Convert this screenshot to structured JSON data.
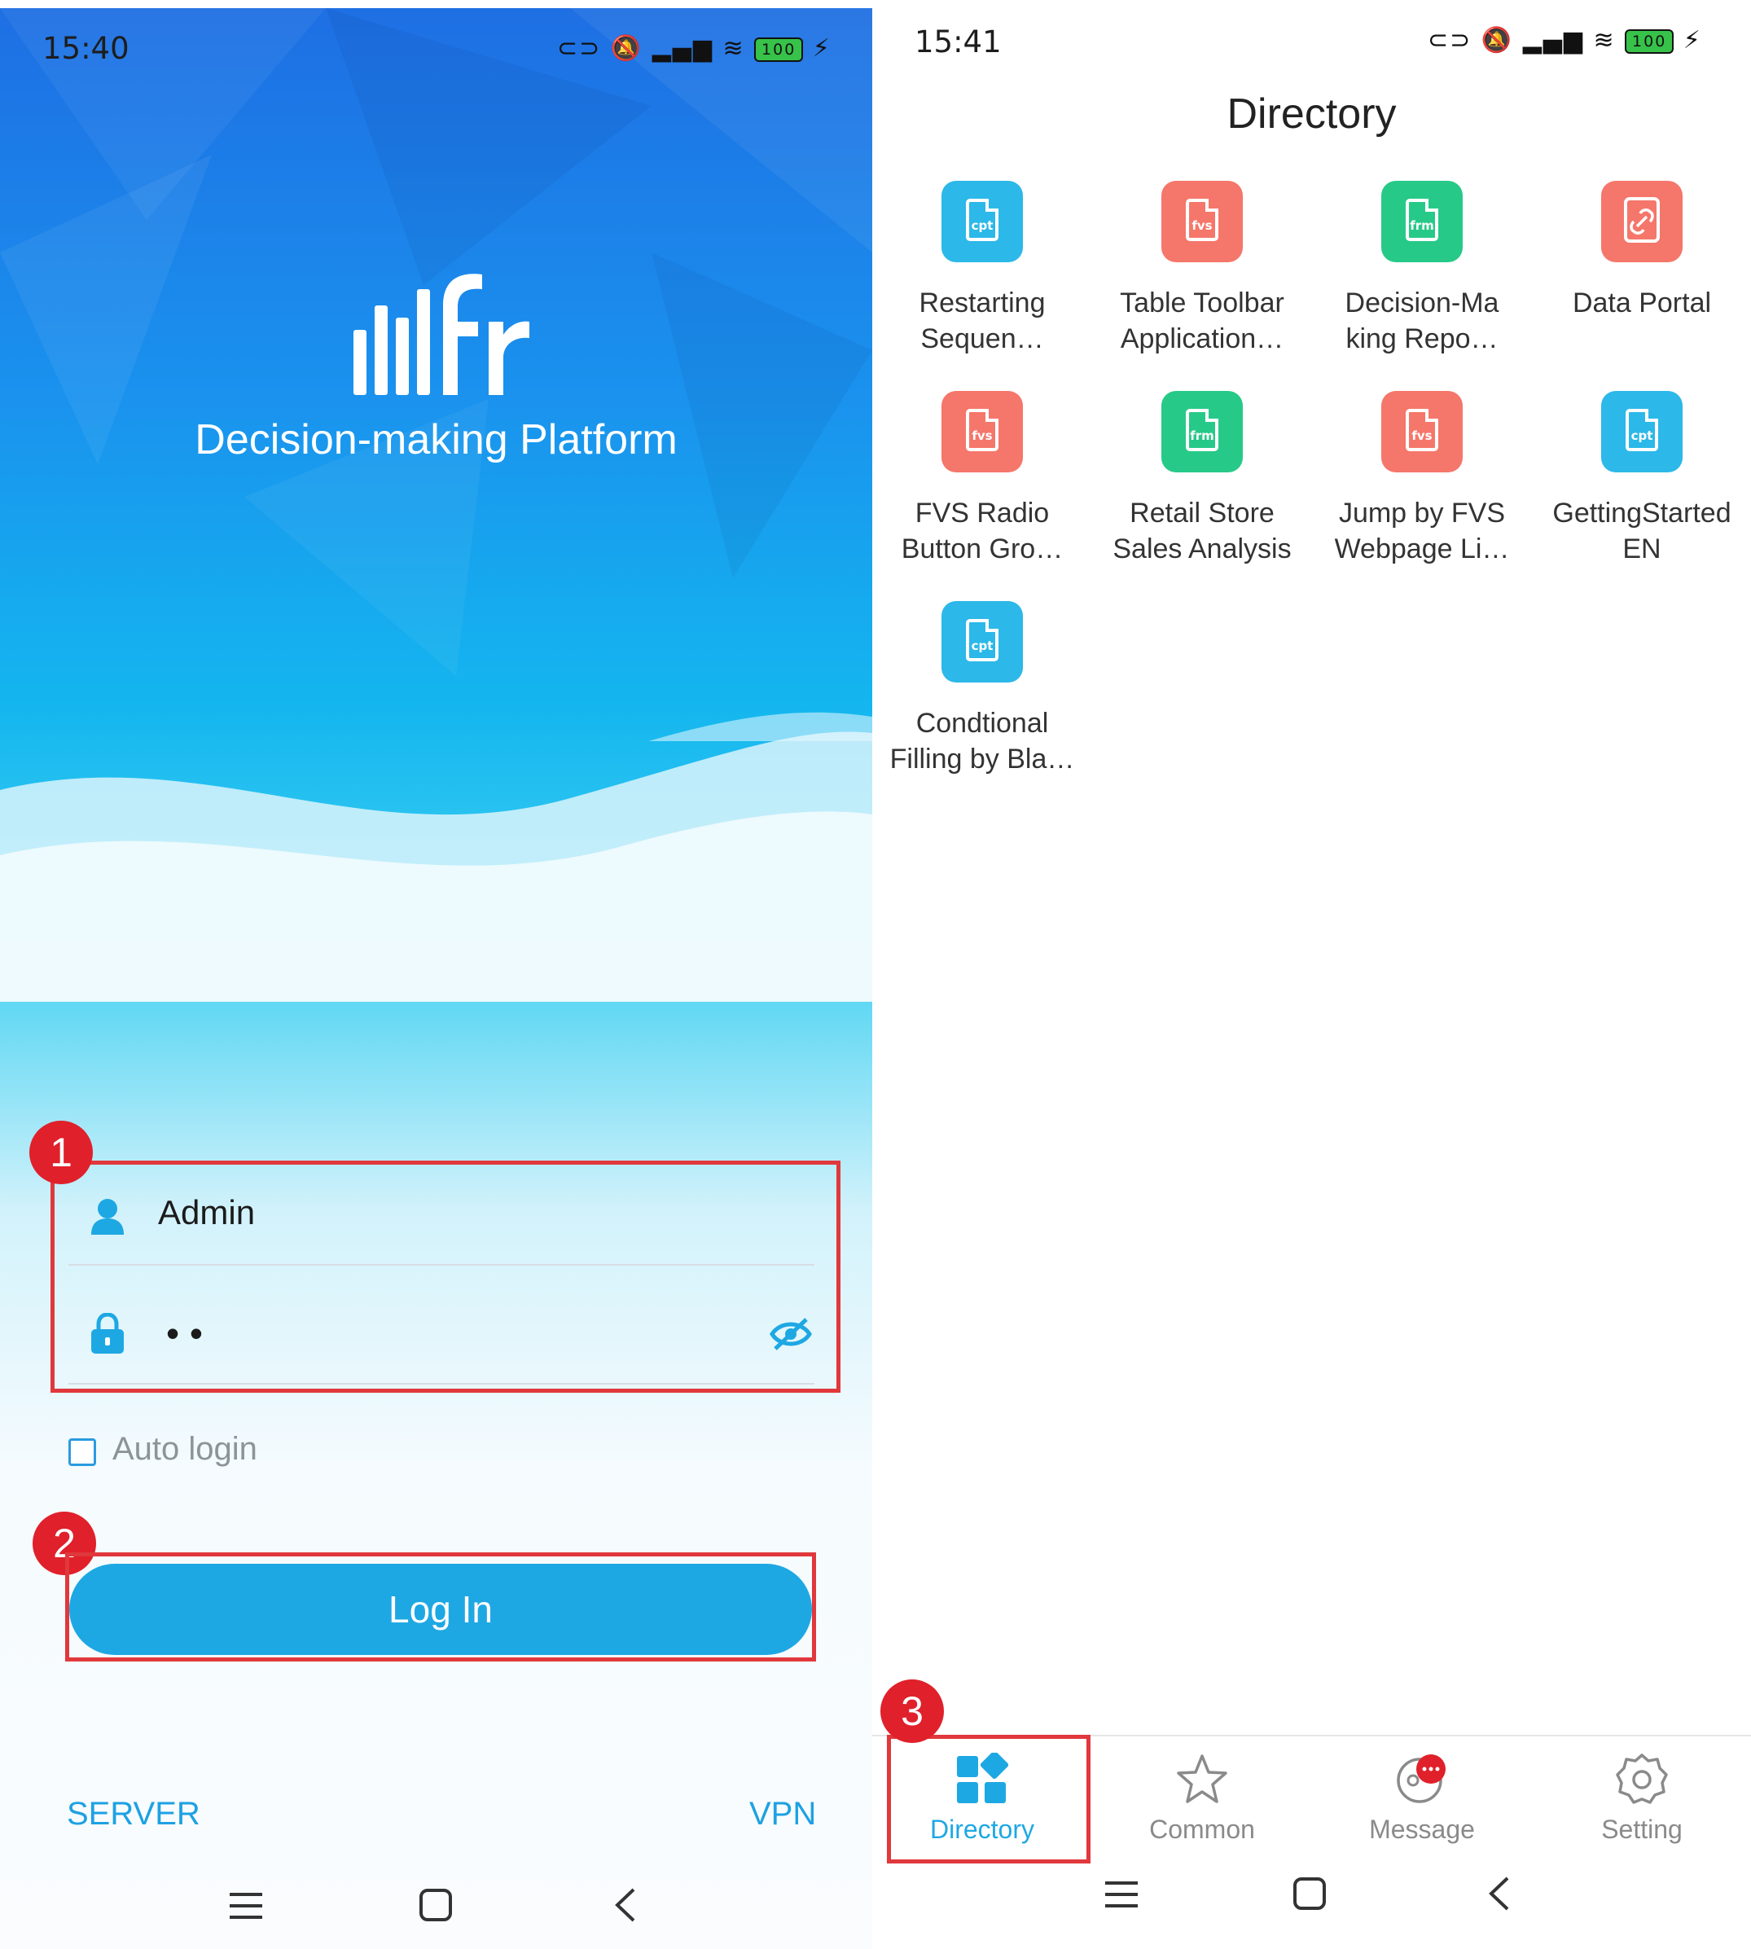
{
  "left_screen": {
    "status_time": "15:40",
    "battery": "100",
    "app_title": "Decision-making Platform",
    "username": "Admin",
    "password_mask": "• •",
    "auto_login_label": "Auto login",
    "login_button": "Log In",
    "server_link": "SERVER",
    "vpn_link": "VPN",
    "annotations": [
      "1",
      "2"
    ]
  },
  "right_screen": {
    "status_time": "15:41",
    "battery": "100",
    "title": "Directory",
    "tiles": [
      {
        "label": "Restarting\nSequen…",
        "type": "cpt",
        "color": "#2cb8e8",
        "icon": "cpt-file-icon"
      },
      {
        "label": "Table Toolbar\nApplication…",
        "type": "fvs",
        "color": "#f5766a",
        "icon": "fvs-file-icon"
      },
      {
        "label": "Decision-Ma\nking Repo…",
        "type": "frm",
        "color": "#27c988",
        "icon": "frm-file-icon"
      },
      {
        "label": "Data Portal",
        "type": "",
        "color": "#f5766a",
        "icon": "link-icon"
      },
      {
        "label": "FVS Radio\nButton Gro…",
        "type": "fvs",
        "color": "#f5766a",
        "icon": "fvs-file-icon"
      },
      {
        "label": "Retail Store\nSales Analysis",
        "type": "frm",
        "color": "#27c988",
        "icon": "frm-file-icon"
      },
      {
        "label": "Jump by FVS\nWebpage Li…",
        "type": "fvs",
        "color": "#f5766a",
        "icon": "fvs-file-icon"
      },
      {
        "label": "GettingStarted\nEN",
        "type": "cpt",
        "color": "#2cb8e8",
        "icon": "cpt-file-icon"
      },
      {
        "label": "Condtional\nFilling by Bla…",
        "type": "cpt",
        "color": "#2cb8e8",
        "icon": "cpt-file-icon"
      }
    ],
    "tabs": [
      {
        "label": "Directory",
        "active": true
      },
      {
        "label": "Common",
        "active": false
      },
      {
        "label": "Message",
        "active": false
      },
      {
        "label": "Setting",
        "active": false
      }
    ],
    "annotation": "3"
  },
  "colors": {
    "accent": "#1ea8e3",
    "highlight": "#e0383c",
    "badge": "#e0202a"
  }
}
